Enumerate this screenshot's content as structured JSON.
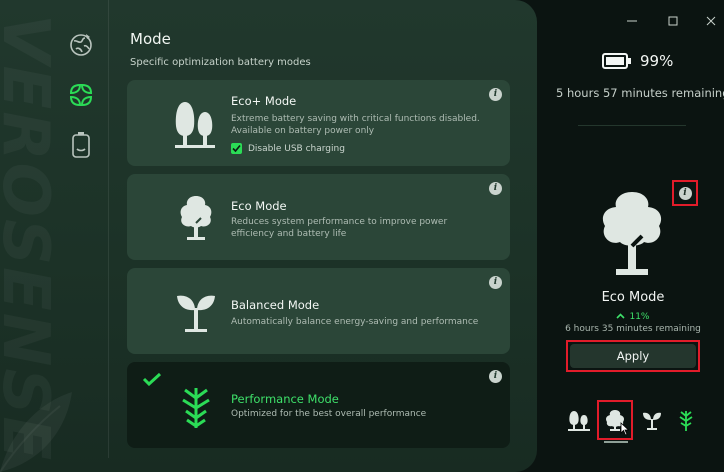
{
  "app": {
    "watermark": "VEROSENSE"
  },
  "nav": {
    "items": [
      {
        "name": "globe",
        "active": false
      },
      {
        "name": "leaf",
        "active": true
      },
      {
        "name": "battery",
        "active": false
      }
    ]
  },
  "header": {
    "title": "Mode",
    "subtitle": "Specific optimization battery modes"
  },
  "modes": [
    {
      "title": "Eco+ Mode",
      "description": "Extreme battery saving with critical functions disabled. Available on battery power only",
      "checkbox_label": "Disable USB charging",
      "checkbox_checked": true,
      "icon": "two-trees-icon",
      "selected": false
    },
    {
      "title": "Eco Mode",
      "description": "Reduces system performance to improve power efficiency and battery life",
      "icon": "tree-icon",
      "selected": false
    },
    {
      "title": "Balanced Mode",
      "description": "Automatically balance energy-saving and performance",
      "icon": "sprout-icon",
      "selected": false
    },
    {
      "title": "Performance Mode",
      "description": "Optimized for the best overall performance",
      "icon": "branch-icon",
      "selected": true
    }
  ],
  "window": {
    "minimize": "minimize",
    "maximize": "maximize",
    "close": "close"
  },
  "status": {
    "battery_percent": "99%",
    "remaining": "5 hours 57 minutes remaining"
  },
  "preview": {
    "mode_name": "Eco Mode",
    "gain": "11%",
    "remaining": "6 hours 35 minutes remaining",
    "apply_label": "Apply"
  },
  "colors": {
    "accent": "#3ee06a",
    "highlight": "#e21c2a",
    "card": "#2b4638",
    "card_selected": "#0f1d16"
  }
}
